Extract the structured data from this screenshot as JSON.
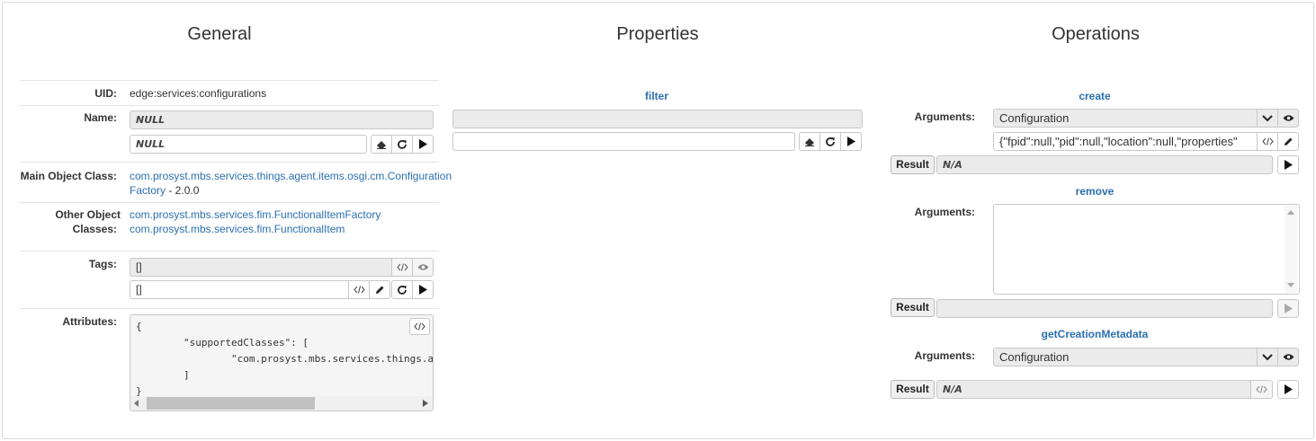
{
  "general": {
    "title": "General",
    "uid_label": "UID:",
    "uid_value": "edge:services:configurations",
    "name_label": "Name:",
    "name_readonly": "NULL",
    "name_input": "NULL",
    "main_class_label": "Main Object Class:",
    "main_class_line1": "com.prosyst.mbs.services.things.agent.items.osgi.cm.Configuration",
    "main_class_line2": "Factory",
    "main_class_version": " - 2.0.0",
    "other_classes_label_1": "Other Object",
    "other_classes_label_2": "Classes:",
    "other_classes": [
      "com.prosyst.mbs.services.fim.FunctionalItemFactory",
      "com.prosyst.mbs.services.fim.FunctionalItem"
    ],
    "tags_label": "Tags:",
    "tags_readonly": "[]",
    "tags_input": "[]",
    "attributes_label": "Attributes:",
    "attributes_code": "{\n        \"supportedClasses\": [\n                \"com.prosyst.mbs.services.things.age\n        ]\n}"
  },
  "properties": {
    "title": "Properties",
    "filter_label": "filter"
  },
  "operations": {
    "title": "Operations",
    "create": {
      "name": "create",
      "arguments_label": "Arguments:",
      "select_value": "Configuration",
      "json_value": "{\"fpid\":null,\"pid\":null,\"location\":null,\"properties\"",
      "result_label": "Result",
      "result_value": "N/A"
    },
    "remove": {
      "name": "remove",
      "arguments_label": "Arguments:",
      "result_label": "Result",
      "result_value": ""
    },
    "get_creation_metadata": {
      "name": "getCreationMetadata",
      "arguments_label": "Arguments:",
      "select_value": "Configuration",
      "result_label": "Result",
      "result_value": "N/A"
    }
  },
  "colors": {
    "link": "#2a6fb0",
    "readonly_bg": "#ebebeb",
    "border": "#c8c8c8"
  },
  "icons": [
    "eraser-icon",
    "refresh-icon",
    "play-icon",
    "code-icon",
    "eye-icon",
    "pencil-icon",
    "chevron-down-icon"
  ]
}
